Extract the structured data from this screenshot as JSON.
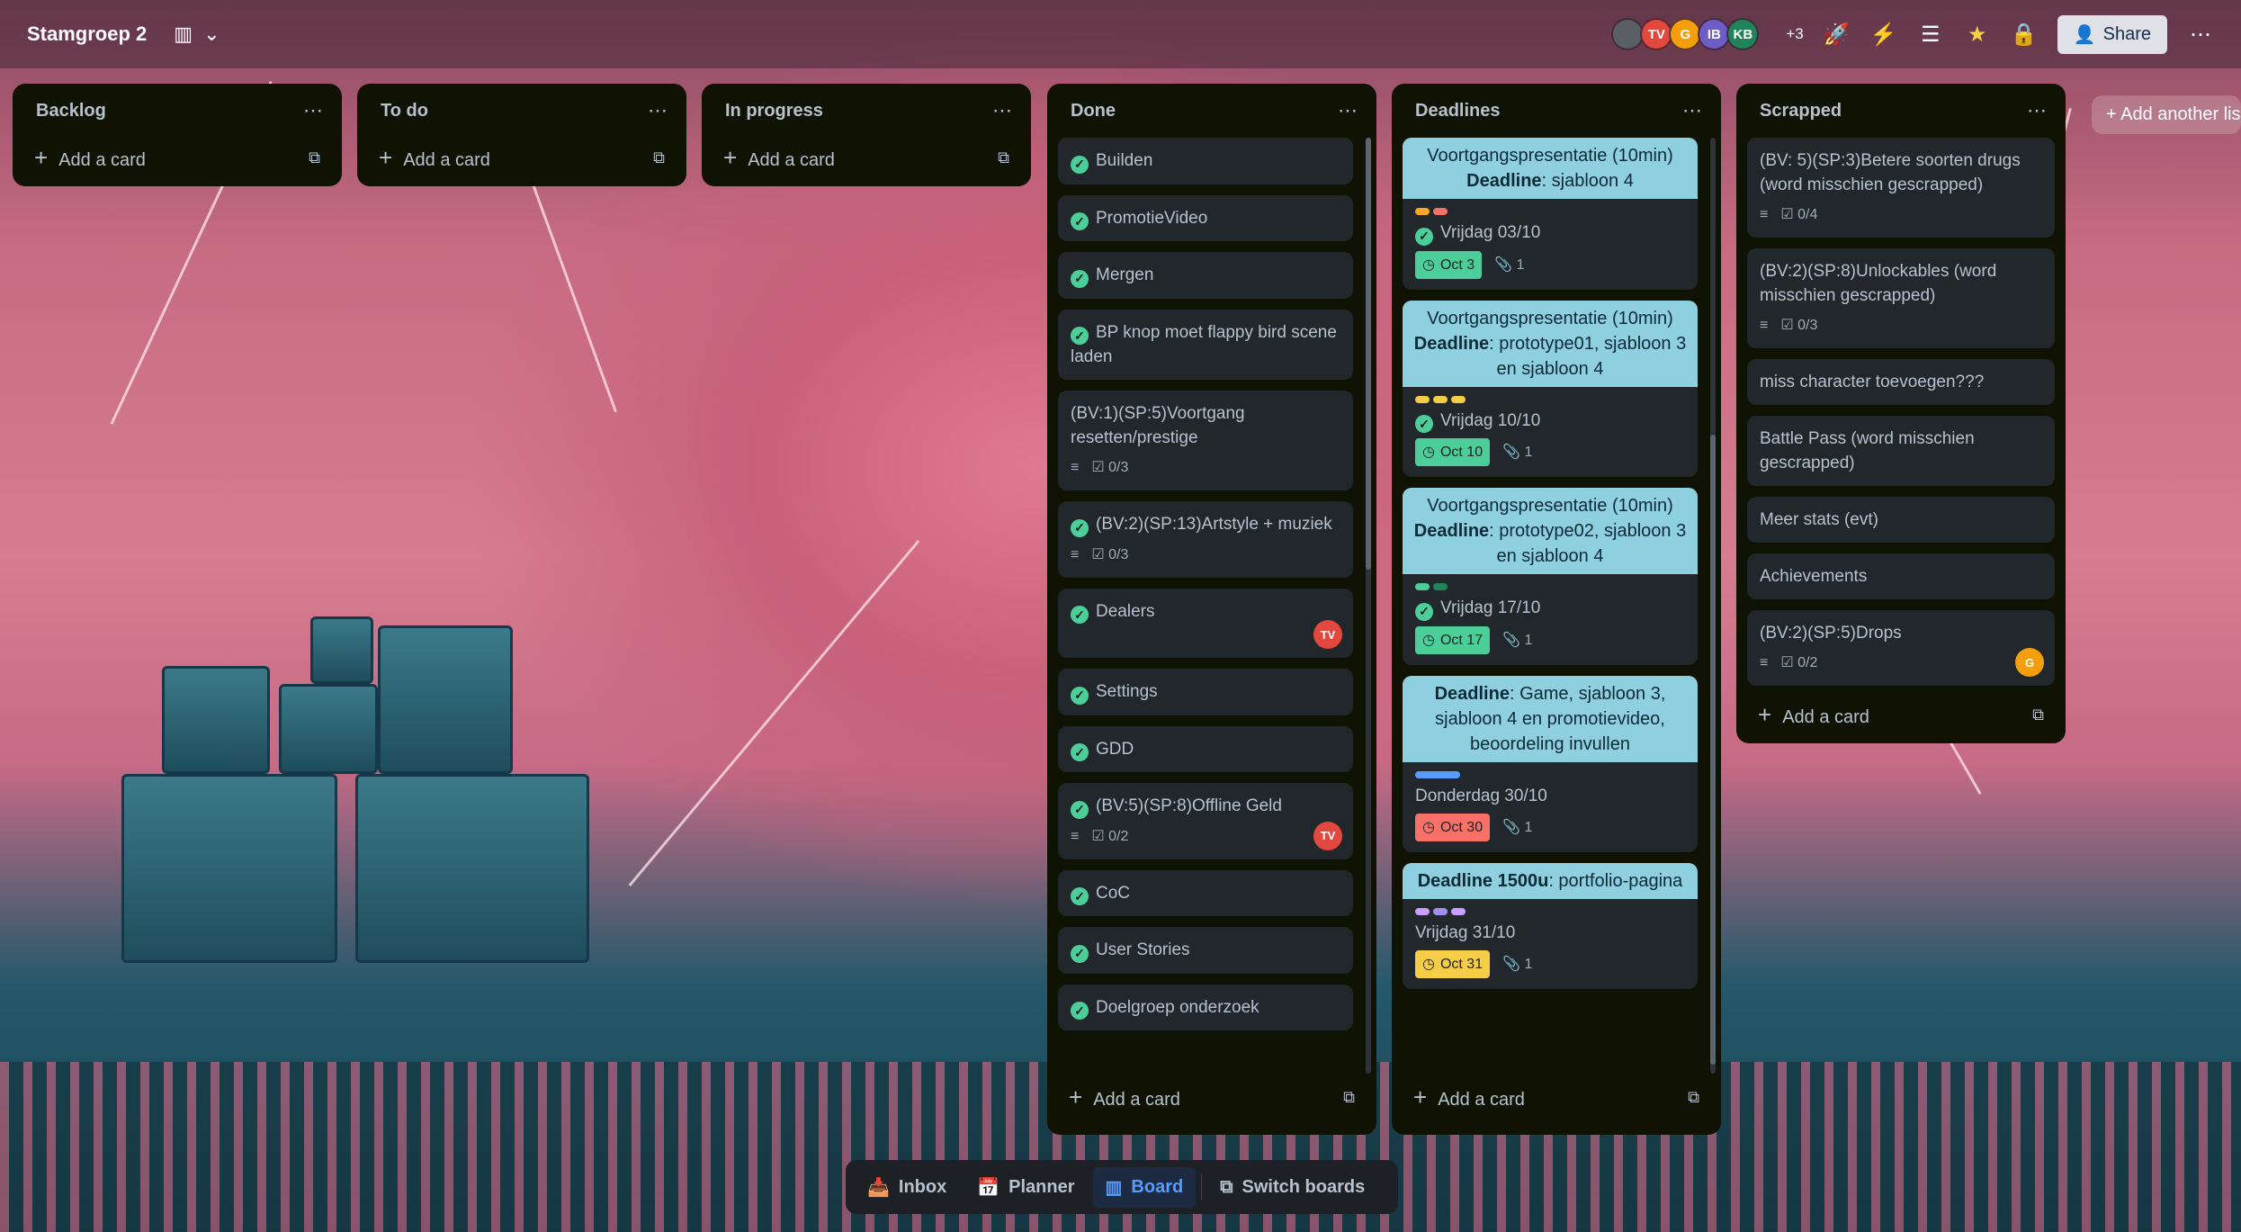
{
  "header": {
    "board_title": "Stamgroep 2",
    "members": [
      {
        "initials": "",
        "color": "#5a5f66"
      },
      {
        "initials": "TV",
        "color": "#e2483d"
      },
      {
        "initials": "G",
        "color": "#f59e0b"
      },
      {
        "initials": "IB",
        "color": "#6e5dc6"
      },
      {
        "initials": "KB",
        "color": "#1f845a"
      }
    ],
    "members_more": "+3",
    "share_label": "Share"
  },
  "lists": {
    "backlog": {
      "title": "Backlog",
      "add_card": "Add a card"
    },
    "todo": {
      "title": "To do",
      "add_card": "Add a card"
    },
    "in_progress": {
      "title": "In progress",
      "add_card": "Add a card"
    },
    "done": {
      "title": "Done",
      "add_card": "Add a card",
      "cards": [
        {
          "title": "Builden"
        },
        {
          "title": "PromotieVideo"
        },
        {
          "title": "Mergen"
        },
        {
          "title": "BP knop moet flappy bird scene laden"
        },
        {
          "title": "(BV:1)(SP:5)Voortgang resetten/prestige",
          "checklist": "0/3"
        },
        {
          "title": "(BV:2)(SP:13)Artstyle + muziek",
          "checklist": "0/3"
        },
        {
          "title": "Dealers",
          "member": "TV"
        },
        {
          "title": "Settings"
        },
        {
          "title": "GDD"
        },
        {
          "title": "(BV:5)(SP:8)Offline Geld",
          "checklist": "0/2",
          "member": "TV"
        },
        {
          "title": "CoC"
        },
        {
          "title": "User Stories"
        },
        {
          "title": "Doelgroep onderzoek"
        }
      ]
    },
    "deadlines": {
      "title": "Deadlines",
      "add_card": "Add a card",
      "cards": [
        {
          "cover_line1": "Voortgangspresentatie (10min)",
          "cover_bold": "Deadline",
          "cover_rest": ": sjabloon 4",
          "title": "Vrijdag 03/10",
          "date": "Oct 3",
          "attachments": "1"
        },
        {
          "cover_line1": "Voortgangspresentatie (10min)",
          "cover_bold": "Deadline",
          "cover_rest": ": prototype01, sjabloon 3 en sjabloon 4",
          "title": "Vrijdag 10/10",
          "date": "Oct 10",
          "attachments": "1"
        },
        {
          "cover_line1": "Voortgangspresentatie (10min)",
          "cover_bold": "Deadline",
          "cover_rest": ": prototype02, sjabloon 3 en sjabloon 4",
          "title": "Vrijdag 17/10",
          "date": "Oct 17",
          "attachments": "1"
        },
        {
          "cover_line1": "",
          "cover_bold": "Deadline",
          "cover_rest": ": Game, sjabloon 3, sjabloon 4 en promotievideo, beoordeling invullen",
          "title": "Donderdag 30/10",
          "date": "Oct 30",
          "attachments": "1"
        },
        {
          "cover_line1": "",
          "cover_bold": "Deadline 1500u",
          "cover_rest": ": portfolio-pagina",
          "title": "Vrijdag 31/10",
          "date": "Oct 31",
          "attachments": "1"
        }
      ]
    },
    "scrapped": {
      "title": "Scrapped",
      "add_card": "Add a card",
      "cards": [
        {
          "title": "(BV: 5)(SP:3)Betere soorten drugs (word misschien gescrapped)",
          "checklist": "0/4"
        },
        {
          "title": "(BV:2)(SP:8)Unlockables (word misschien gescrapped)",
          "checklist": "0/3"
        },
        {
          "title": "miss character toevoegen???"
        },
        {
          "title": "Battle Pass (word misschien gescrapped)"
        },
        {
          "title": "Meer stats (evt)"
        },
        {
          "title": "Achievements"
        },
        {
          "title": "(BV:2)(SP:5)Drops",
          "checklist": "0/2",
          "member": "G"
        }
      ]
    }
  },
  "add_list_label": "Add another list",
  "bottom_nav": {
    "inbox": "Inbox",
    "planner": "Planner",
    "board": "Board",
    "switch": "Switch boards"
  },
  "colors": {
    "done_check": "#4bce97",
    "date_green": "#4bce97",
    "date_yellow": "#f5cd47",
    "date_red": "#f87168",
    "cover": "#8fd0e0"
  }
}
